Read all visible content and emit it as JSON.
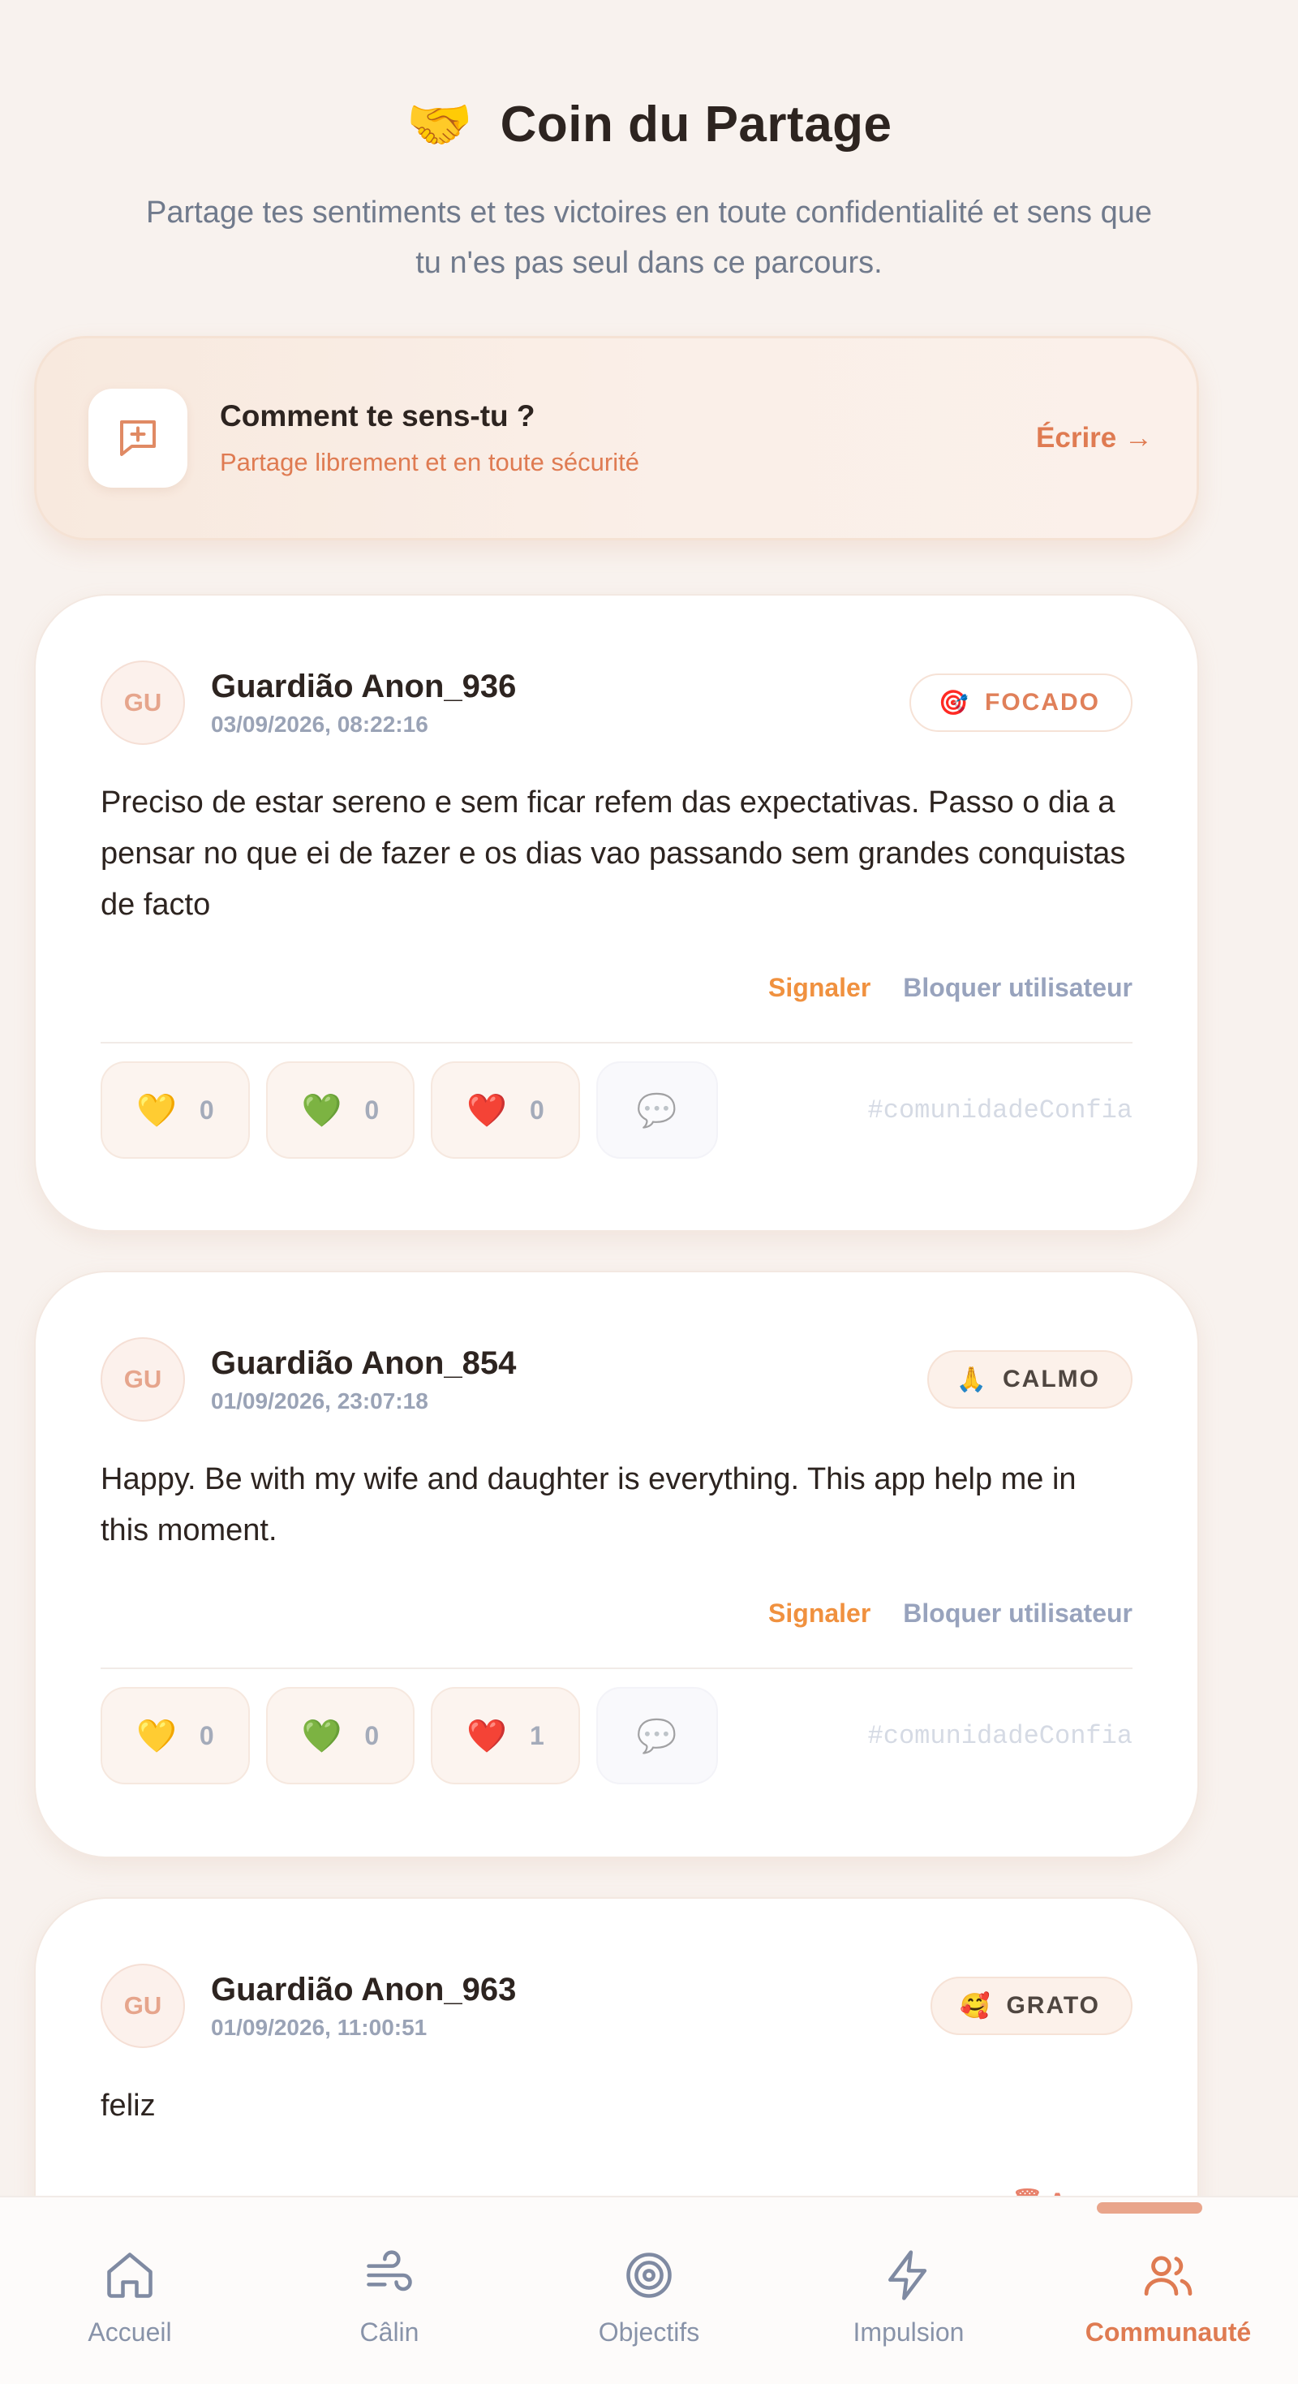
{
  "header": {
    "emoji": "🤝",
    "title": "Coin du Partage",
    "subtitle": "Partage tes sentiments et tes victoires en toute confidentialité et sens que tu n'es pas seul dans ce parcours."
  },
  "compose": {
    "icon": "message-plus-icon",
    "title": "Comment te sens-tu ?",
    "subtitle": "Partage librement et en toute sécurité",
    "action": "Écrire →"
  },
  "posts": [
    {
      "avatar": "GU",
      "author": "Guardião Anon_936",
      "date": "03/09/2026, 08:22:16",
      "mood_emoji": "🎯",
      "mood": "FOCADO",
      "body": "Preciso de estar sereno e sem ficar refem das expectativas. Passo o dia a pensar no que ei de fazer e os dias vao passando sem grandes conquistas de facto",
      "report": "Signaler",
      "block": "Bloquer utilisateur",
      "reactions": [
        {
          "emoji": "💛",
          "count": "0"
        },
        {
          "emoji": "💚",
          "count": "0"
        },
        {
          "emoji": "❤️",
          "count": "0"
        }
      ],
      "comment_emoji": "💬",
      "hashtag": "#comunidadeConfia"
    },
    {
      "avatar": "GU",
      "author": "Guardião Anon_854",
      "date": "01/09/2026, 23:07:18",
      "mood_emoji": "🙏",
      "mood": "CALMO",
      "body": "Happy. Be with my wife and daughter is everything. This app help me in this moment.",
      "report": "Signaler",
      "block": "Bloquer utilisateur",
      "reactions": [
        {
          "emoji": "💛",
          "count": "0"
        },
        {
          "emoji": "💚",
          "count": "0"
        },
        {
          "emoji": "❤️",
          "count": "1"
        }
      ],
      "comment_emoji": "💬",
      "hashtag": "#comunidadeConfia"
    },
    {
      "avatar": "GU",
      "author": "Guardião Anon_963",
      "date": "01/09/2026, 11:00:51",
      "mood_emoji": "🥰",
      "mood": "GRATO",
      "body": "feliz",
      "partial_action": "🗑 Apagar"
    }
  ],
  "nav": [
    {
      "label": "Accueil",
      "icon": "home-icon"
    },
    {
      "label": "Câlin",
      "icon": "wind-icon"
    },
    {
      "label": "Objectifs",
      "icon": "target-icon"
    },
    {
      "label": "Impulsion",
      "icon": "lightning-icon"
    },
    {
      "label": "Communauté",
      "icon": "users-icon",
      "active": true
    }
  ],
  "colors": {
    "accent": "#df7b52",
    "background": "#f8f2ee",
    "report": "#f0913f",
    "muted": "#98a3bd"
  }
}
